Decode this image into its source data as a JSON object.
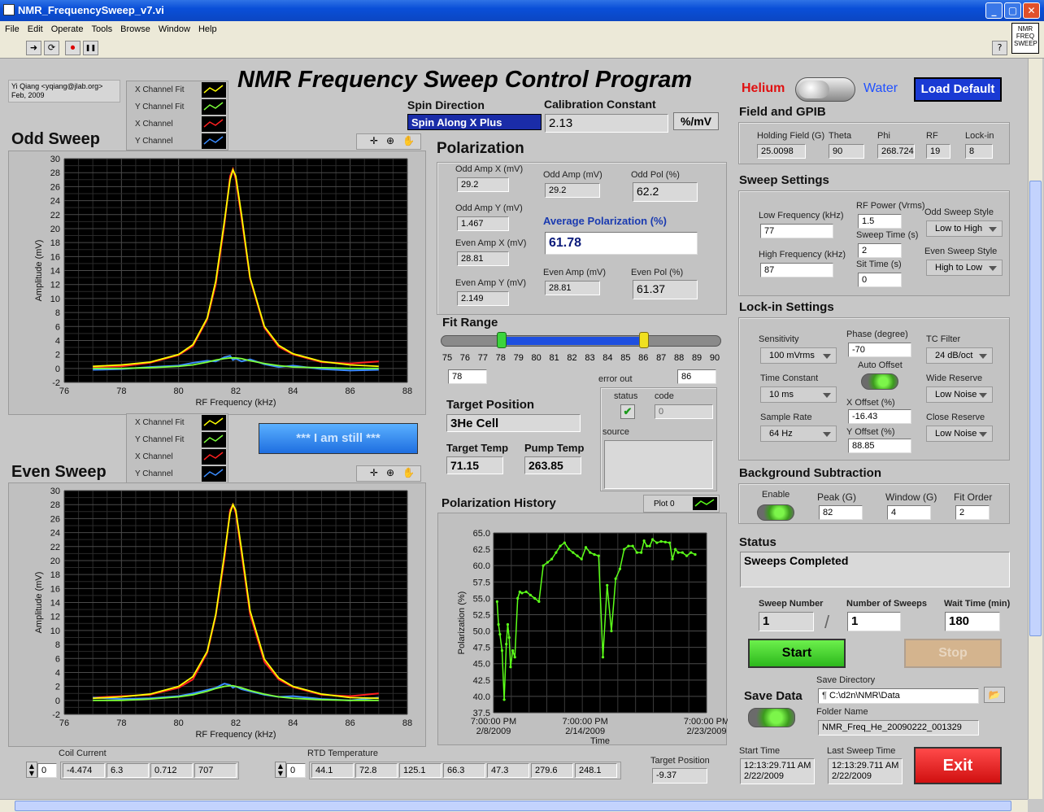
{
  "window": {
    "title": "NMR_FrequencySweep_v7.vi",
    "min": "_",
    "max": "▢",
    "close": "✕"
  },
  "menu": [
    "File",
    "Edit",
    "Operate",
    "Tools",
    "Browse",
    "Window",
    "Help"
  ],
  "toolbar": {
    "run": "➜",
    "run_cont": "⟳",
    "abort": "⏺",
    "pause": "❚❚",
    "help": "?",
    "vi_icon": "NMR FREQ SWEEP"
  },
  "author": {
    "line1": "Yi Qiang <yqiang@jlab.org>",
    "line2": "Feb, 2009"
  },
  "main_title": "NMR Frequency Sweep Control Program",
  "switch": {
    "left": "Helium",
    "right": "Water"
  },
  "load_default": "Load Default",
  "spin_direction": {
    "label": "Spin Direction",
    "value": "Spin Along X Plus"
  },
  "calibration": {
    "label": "Calibration Constant",
    "value": "2.13",
    "unit": "%/mV"
  },
  "legend": [
    "X Channel Fit",
    "Y Channel Fit",
    "X Channel",
    "Y Channel"
  ],
  "odd_sweep": {
    "title": "Odd Sweep",
    "ylabel": "Amplitude (mV)",
    "xlabel": "RF Frequency (kHz)"
  },
  "even_sweep": {
    "title": "Even Sweep",
    "ylabel": "Amplitude (mV)",
    "xlabel": "RF Frequency (kHz)"
  },
  "still_button": "*** I am still ***",
  "polarization": {
    "title": "Polarization",
    "odd_amp_x": {
      "label": "Odd Amp X (mV)",
      "value": "29.2"
    },
    "odd_amp": {
      "label": "Odd Amp (mV)",
      "value": "29.2"
    },
    "odd_pol": {
      "label": "Odd Pol (%)",
      "value": "62.2"
    },
    "odd_amp_y": {
      "label": "Odd Amp Y (mV)",
      "value": "1.467"
    },
    "avg_pol": {
      "label": "Average Polarization (%)",
      "value": "61.78"
    },
    "even_amp_x": {
      "label": "Even Amp X (mV)",
      "value": "28.81"
    },
    "even_amp": {
      "label": "Even Amp (mV)",
      "value": "28.81"
    },
    "even_pol": {
      "label": "Even Pol (%)",
      "value": "61.37"
    },
    "even_amp_y": {
      "label": "Even Amp Y (mV)",
      "value": "2.149"
    }
  },
  "fit_range": {
    "label": "Fit Range",
    "ticks": [
      "75",
      "76",
      "77",
      "78",
      "79",
      "80",
      "81",
      "82",
      "83",
      "84",
      "85",
      "86",
      "87",
      "88",
      "89",
      "90"
    ],
    "low": "78",
    "high": "86",
    "low_val": 78,
    "high_val": 86
  },
  "target_position": {
    "label": "Target Position",
    "value": "3He Cell"
  },
  "target_temp": {
    "label": "Target Temp",
    "value": "71.15"
  },
  "pump_temp": {
    "label": "Pump Temp",
    "value": "263.85"
  },
  "error_out": {
    "label": "error out",
    "status": "status",
    "code": "code",
    "code_value": "0",
    "source": "source",
    "check": "✔"
  },
  "pol_history": {
    "title": "Polarization History",
    "plot_label": "Plot 0",
    "ylabel": "Polarization (%)",
    "xlabel": "Time",
    "yticks": [
      "65.0",
      "62.5",
      "60.0",
      "57.5",
      "55.0",
      "52.5",
      "50.0",
      "47.5",
      "45.0",
      "42.5",
      "40.0",
      "37.5"
    ],
    "xticks": [
      {
        "time": "7:00:00 PM",
        "date": "2/8/2009"
      },
      {
        "time": "7:00:00 PM",
        "date": "2/14/2009"
      },
      {
        "time": "7:00:00 PM",
        "date": "2/23/2009"
      }
    ]
  },
  "field_gpib": {
    "title": "Field and GPIB",
    "holding_field": {
      "label": "Holding Field (G)",
      "value": "25.0098"
    },
    "theta": {
      "label": "Theta",
      "value": "90"
    },
    "phi": {
      "label": "Phi",
      "value": "268.724"
    },
    "rf": {
      "label": "RF",
      "value": "19"
    },
    "lockin": {
      "label": "Lock-in",
      "value": "8"
    }
  },
  "sweep_settings": {
    "title": "Sweep Settings",
    "low_freq": {
      "label": "Low Frequency (kHz)",
      "value": "77"
    },
    "high_freq": {
      "label": "High Frequency (kHz)",
      "value": "87"
    },
    "rf_power": {
      "label": "RF Power (Vrms)",
      "value": "1.5"
    },
    "sweep_time": {
      "label": "Sweep Time (s)",
      "value": "2"
    },
    "sit_time": {
      "label": "Sit Time (s)",
      "value": "0"
    },
    "odd_style": {
      "label": "Odd Sweep Style",
      "value": "Low to High"
    },
    "even_style": {
      "label": "Even Sweep Style",
      "value": "High to Low"
    }
  },
  "lockin_settings": {
    "title": "Lock-in Settings",
    "sensitivity": {
      "label": "Sensitivity",
      "value": "100 mVrms"
    },
    "phase": {
      "label": "Phase (degree)",
      "value": "-70"
    },
    "tc_filter": {
      "label": "TC Filter",
      "value": "24 dB/oct"
    },
    "auto_offset": "Auto Offset",
    "time_constant": {
      "label": "Time Constant",
      "value": "10 ms"
    },
    "wide_reserve": {
      "label": "Wide Reserve",
      "value": "Low Noise"
    },
    "x_offset": {
      "label": "X Offset (%)",
      "value": "-16.43"
    },
    "sample_rate": {
      "label": "Sample Rate",
      "value": "64 Hz"
    },
    "close_reserve": {
      "label": "Close Reserve",
      "value": "Low Noise"
    },
    "y_offset": {
      "label": "Y Offset (%)",
      "value": "88.85"
    }
  },
  "background": {
    "title": "Background Subtraction",
    "enable": "Enable",
    "peak": {
      "label": "Peak (G)",
      "value": "82"
    },
    "window": {
      "label": "Window (G)",
      "value": "4"
    },
    "fit_order": {
      "label": "Fit Order",
      "value": "2"
    }
  },
  "status": {
    "title": "Status",
    "value": "Sweeps Completed"
  },
  "sweep_number": {
    "label": "Sweep Number",
    "value": "1"
  },
  "num_sweeps": {
    "label": "Number of Sweeps",
    "value": "1"
  },
  "wait_time": {
    "label": "Wait Time (min)",
    "value": "180"
  },
  "start": "Start",
  "stop": "Stop",
  "save_data": {
    "label": "Save Data",
    "dir_label": "Save Directory",
    "dir": "C:\\d2n\\NMR\\Data",
    "folder_label": "Folder Name",
    "folder": "NMR_Freq_He_20090222_001329"
  },
  "start_time": {
    "label": "Start Time",
    "time": "12:13:29.711 AM",
    "date": "2/22/2009"
  },
  "last_sweep": {
    "label": "Last Sweep Time",
    "time": "12:13:29.711 AM",
    "date": "2/22/2009"
  },
  "exit": "Exit",
  "coil_current": {
    "label": "Coil Current",
    "index": "0",
    "values": [
      "-4.474",
      "6.3",
      "0.712",
      "707"
    ]
  },
  "rtd_temp": {
    "label": "RTD Temperature",
    "index": "0",
    "values": [
      "44.1",
      "72.8",
      "125.1",
      "66.3",
      "47.3",
      "279.6",
      "248.1"
    ]
  },
  "target_pos_bottom": {
    "label": "Target Position",
    "value": "-9.37"
  },
  "colors": {
    "x_fit": "#ffff00",
    "y_fit": "#7cff3a",
    "x_ch": "#ff2020",
    "y_ch": "#3a8cff",
    "history": "#5cff1a"
  },
  "chart_data": [
    {
      "type": "line",
      "title": "Odd Sweep",
      "xlabel": "RF Frequency (kHz)",
      "ylabel": "Amplitude (mV)",
      "xlim": [
        76,
        88
      ],
      "ylim": [
        -2,
        30
      ],
      "x": [
        77,
        78,
        79,
        80,
        80.5,
        81,
        81.3,
        81.6,
        81.8,
        81.9,
        82,
        82.2,
        82.5,
        83,
        83.5,
        84,
        85,
        86,
        87
      ],
      "series": [
        {
          "name": "X Channel Fit",
          "values": [
            0.3,
            0.5,
            0.9,
            2.0,
            3.4,
            7.2,
            12.5,
            21,
            27,
            28.4,
            27.5,
            22,
            13,
            6,
            3.3,
            2.1,
            1.0,
            0.5,
            0.3
          ]
        },
        {
          "name": "Y Channel Fit",
          "values": [
            0,
            0,
            0.1,
            0.3,
            0.5,
            0.9,
            1.2,
            1.4,
            1.5,
            1.5,
            1.5,
            1.4,
            1.1,
            0.7,
            0.4,
            0.2,
            0.1,
            0,
            0
          ]
        },
        {
          "name": "X Channel",
          "values": [
            0.2,
            0.3,
            0.8,
            1.9,
            3.2,
            7.0,
            12.0,
            20.5,
            27.5,
            28.5,
            27.0,
            21.5,
            12.8,
            5.8,
            3.1,
            2.0,
            0.9,
            0.7,
            1.0
          ]
        },
        {
          "name": "Y Channel",
          "values": [
            -0.2,
            -0.1,
            0.2,
            0.4,
            0.8,
            1.1,
            1.0,
            1.6,
            1.8,
            1.2,
            1.4,
            1.0,
            1.3,
            0.6,
            0.2,
            0.4,
            -0.1,
            -0.3,
            -0.2
          ]
        }
      ]
    },
    {
      "type": "line",
      "title": "Even Sweep",
      "xlabel": "RF Frequency (kHz)",
      "ylabel": "Amplitude (mV)",
      "xlim": [
        76,
        88
      ],
      "ylim": [
        -2,
        30
      ],
      "x": [
        77,
        78,
        79,
        80,
        80.5,
        81,
        81.3,
        81.6,
        81.8,
        81.9,
        82,
        82.2,
        82.5,
        83,
        83.5,
        84,
        85,
        86,
        87
      ],
      "series": [
        {
          "name": "X Channel Fit",
          "values": [
            0.3,
            0.5,
            0.9,
            2.0,
            3.4,
            7.0,
            12.3,
            20.8,
            26.8,
            28.0,
            27.2,
            21.6,
            12.8,
            5.9,
            3.2,
            2.0,
            0.9,
            0.4,
            0.3
          ]
        },
        {
          "name": "Y Channel Fit",
          "values": [
            0,
            0,
            0.2,
            0.5,
            0.8,
            1.3,
            1.7,
            2.0,
            2.1,
            2.1,
            2.0,
            1.8,
            1.4,
            0.9,
            0.5,
            0.3,
            0.1,
            0,
            0
          ]
        },
        {
          "name": "X Channel",
          "values": [
            0.4,
            0.6,
            0.8,
            1.8,
            3.0,
            6.8,
            12.1,
            20.2,
            27.2,
            28.0,
            26.8,
            21.0,
            12.3,
            5.5,
            3.0,
            1.9,
            0.8,
            0.6,
            1.0
          ]
        },
        {
          "name": "Y Channel",
          "values": [
            0.4,
            0.2,
            0.3,
            0.6,
            1.0,
            1.5,
            1.8,
            2.4,
            2.2,
            1.8,
            2.0,
            1.6,
            1.3,
            0.8,
            0.5,
            0.6,
            0.2,
            0.0,
            0.4
          ]
        }
      ]
    },
    {
      "type": "line",
      "title": "Polarization History",
      "xlabel": "Time",
      "ylabel": "Polarization (%)",
      "ylim": [
        37.5,
        65
      ],
      "x": [
        0.25,
        0.35,
        0.45,
        0.6,
        0.75,
        0.9,
        1.0,
        1.1,
        1.2,
        1.35,
        1.5,
        1.7,
        1.85,
        2.0,
        2.3,
        2.6,
        2.9,
        3.2,
        3.5,
        3.8,
        4.1,
        4.4,
        4.7,
        5.0,
        5.3,
        5.6,
        5.9,
        6.2,
        6.5,
        6.8,
        7.1,
        7.4,
        7.7,
        8.0,
        8.3,
        8.6,
        8.9,
        9.2,
        9.5,
        9.8,
        10.1,
        10.4,
        10.6,
        10.8,
        11.0,
        11.2,
        11.5,
        11.8,
        12.1,
        12.4,
        12.6,
        12.8,
        13.0,
        13.3,
        13.6,
        13.9,
        14.2
      ],
      "values": [
        54.5,
        51,
        49.5,
        47,
        39.5,
        48,
        51,
        49,
        44.5,
        47,
        46,
        55,
        56,
        55.8,
        56,
        55.5,
        55,
        54.5,
        60,
        60.5,
        61,
        62,
        63,
        63.5,
        62.5,
        62,
        61.5,
        61,
        62.8,
        62,
        61.7,
        61.5,
        46,
        57,
        50,
        58,
        59.5,
        62.5,
        63,
        63,
        62,
        62,
        63.8,
        63,
        63,
        64,
        63.5,
        63.7,
        63.6,
        63.5,
        61,
        62.5,
        62,
        62,
        61.5,
        62,
        61.7
      ]
    }
  ]
}
